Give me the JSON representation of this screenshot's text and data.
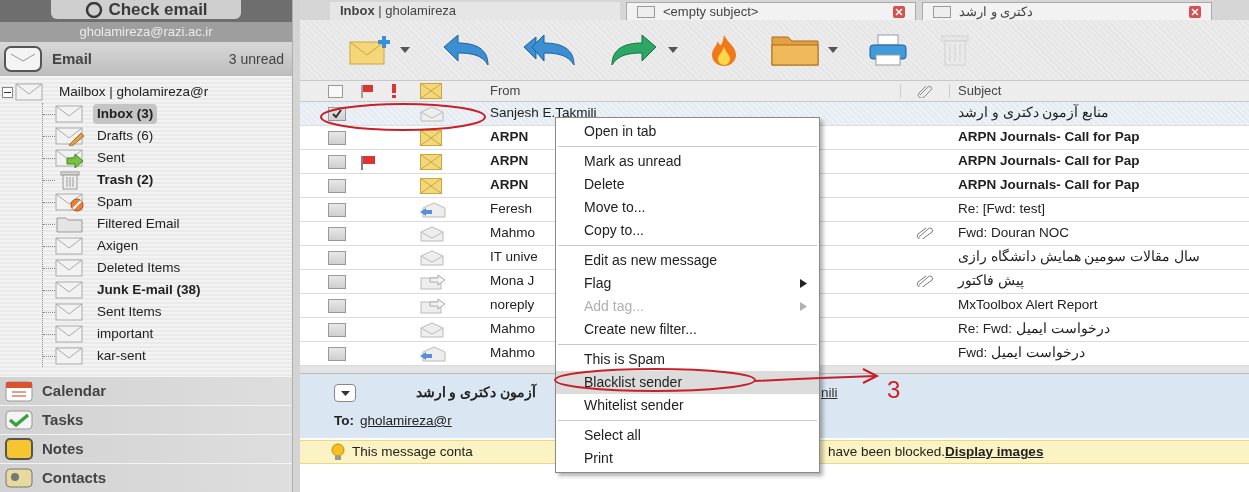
{
  "sidebar": {
    "check_email_button": "Check email",
    "account": "gholamireza@razi.ac.ir",
    "section": {
      "label": "Email",
      "unread": "3 unread"
    },
    "tree": {
      "label": "Mailbox | gholamireza@r",
      "expanded": true,
      "children": [
        {
          "label": "Inbox (3)",
          "kind": "inbox",
          "bold": true,
          "selected": true
        },
        {
          "label": "Drafts (6)",
          "kind": "drafts",
          "bold": false,
          "selected": false
        },
        {
          "label": "Sent",
          "kind": "sent",
          "bold": false,
          "selected": false
        },
        {
          "label": "Trash (2)",
          "kind": "trash",
          "bold": true,
          "selected": false
        },
        {
          "label": "Spam",
          "kind": "spam",
          "bold": false,
          "selected": false
        },
        {
          "label": "Filtered Email",
          "kind": "folder",
          "bold": false,
          "selected": false
        },
        {
          "label": "Axigen",
          "kind": "mail",
          "bold": false,
          "selected": false
        },
        {
          "label": "Deleted Items",
          "kind": "mail",
          "bold": false,
          "selected": false
        },
        {
          "label": "Junk E-mail (38)",
          "kind": "mail",
          "bold": true,
          "selected": false
        },
        {
          "label": "Sent Items",
          "kind": "mail",
          "bold": false,
          "selected": false
        },
        {
          "label": "important",
          "kind": "mail",
          "bold": false,
          "selected": false
        },
        {
          "label": "kar-sent",
          "kind": "mail",
          "bold": false,
          "selected": false
        }
      ]
    },
    "modules": [
      {
        "label": "Calendar",
        "kind": "calendar"
      },
      {
        "label": "Tasks",
        "kind": "tasks"
      },
      {
        "label": "Notes",
        "kind": "notes"
      },
      {
        "label": "Contacts",
        "kind": "contacts"
      }
    ]
  },
  "tabs": [
    {
      "label": "**Inbox** | gholamireza",
      "selected": true,
      "closable": false
    },
    {
      "label": "<empty subject>",
      "selected": false,
      "closable": true
    },
    {
      "label": "دکتری و ارشد",
      "selected": false,
      "closable": true
    }
  ],
  "toolbar": [
    {
      "kind": "new",
      "dropdown": true,
      "disabled": false
    },
    {
      "kind": "reply",
      "dropdown": false,
      "disabled": false
    },
    {
      "kind": "reply_all",
      "dropdown": false,
      "disabled": false
    },
    {
      "kind": "forward",
      "dropdown": true,
      "disabled": false
    },
    {
      "kind": "spam",
      "dropdown": false,
      "disabled": false
    },
    {
      "kind": "move",
      "dropdown": true,
      "disabled": false
    },
    {
      "kind": "print",
      "dropdown": false,
      "disabled": false
    },
    {
      "kind": "delete",
      "dropdown": false,
      "disabled": true
    }
  ],
  "message_list": {
    "select_all": {
      "checked": false
    },
    "columns": {
      "from": "From",
      "subject": "Subject"
    },
    "rows": [
      {
        "checked": true,
        "selected": true,
        "flagged": false,
        "kind": "read",
        "unread": false,
        "from": "Sanjesh E.Takmili",
        "attachment": false,
        "subject": "منابع آزمون دکتری و ارشد"
      },
      {
        "checked": false,
        "selected": false,
        "flagged": false,
        "kind": "unread",
        "unread": true,
        "from": "ARPN",
        "attachment": false,
        "subject": "ARPN Journals- Call for Pap"
      },
      {
        "checked": false,
        "selected": false,
        "flagged": true,
        "kind": "unread",
        "unread": true,
        "from": "ARPN",
        "attachment": false,
        "subject": "ARPN Journals- Call for Pap"
      },
      {
        "checked": false,
        "selected": false,
        "flagged": false,
        "kind": "unread",
        "unread": true,
        "from": "ARPN",
        "attachment": false,
        "subject": "ARPN Journals- Call for Pap"
      },
      {
        "checked": false,
        "selected": false,
        "flagged": false,
        "kind": "replied",
        "unread": false,
        "from": "Feresh",
        "attachment": false,
        "subject": "Re: [Fwd: test]"
      },
      {
        "checked": false,
        "selected": false,
        "flagged": false,
        "kind": "read",
        "unread": false,
        "from": "Mahmo",
        "attachment": true,
        "subject": "Fwd: Douran NOC"
      },
      {
        "checked": false,
        "selected": false,
        "flagged": false,
        "kind": "read",
        "unread": false,
        "from": "IT unive",
        "attachment": false,
        "subject": "سال مقالات سومین همایش دانشگاه رازی"
      },
      {
        "checked": false,
        "selected": false,
        "flagged": false,
        "kind": "forwarded",
        "unread": false,
        "from": "Mona J",
        "attachment": true,
        "subject": "پیش فاکتور"
      },
      {
        "checked": false,
        "selected": false,
        "flagged": false,
        "kind": "forwarded",
        "unread": false,
        "from": "noreply",
        "attachment": false,
        "subject": "MxToolbox Alert Report"
      },
      {
        "checked": false,
        "selected": false,
        "flagged": false,
        "kind": "read",
        "unread": false,
        "from": "Mahmo",
        "attachment": false,
        "subject": "Re: Fwd: درخواست ایمیل"
      },
      {
        "checked": false,
        "selected": false,
        "flagged": false,
        "kind": "replied",
        "unread": false,
        "from": "Mahmo",
        "attachment": false,
        "subject": "Fwd: درخواست ایمیل"
      }
    ]
  },
  "context_menu": {
    "groups": [
      [
        {
          "label": "Open in tab",
          "disabled": false,
          "submenu": false,
          "selected": false
        }
      ],
      [
        {
          "label": "Mark as unread",
          "disabled": false,
          "submenu": false,
          "selected": false
        },
        {
          "label": "Delete",
          "disabled": false,
          "submenu": false,
          "selected": false
        },
        {
          "label": "Move to...",
          "disabled": false,
          "submenu": false,
          "selected": false
        },
        {
          "label": "Copy to...",
          "disabled": false,
          "submenu": false,
          "selected": false
        }
      ],
      [
        {
          "label": "Edit as new message",
          "disabled": false,
          "submenu": false,
          "selected": false
        },
        {
          "label": "Flag",
          "disabled": false,
          "submenu": true,
          "selected": false
        },
        {
          "label": "Add tag...",
          "disabled": true,
          "submenu": true,
          "selected": false
        },
        {
          "label": "Create new filter...",
          "disabled": false,
          "submenu": false,
          "selected": false
        }
      ],
      [
        {
          "label": "This is Spam",
          "disabled": false,
          "submenu": false,
          "selected": false
        },
        {
          "label": "Blacklist sender",
          "disabled": false,
          "submenu": false,
          "selected": true
        },
        {
          "label": "Whitelist sender",
          "disabled": false,
          "submenu": false,
          "selected": false
        }
      ],
      [
        {
          "label": "Select all",
          "disabled": false,
          "submenu": false,
          "selected": false
        },
        {
          "label": "Print",
          "disabled": false,
          "submenu": false,
          "selected": false
        }
      ]
    ]
  },
  "preview": {
    "subject": "آزمون دکتری و ارشد",
    "from": "nili",
    "to_label": "To:",
    "to": "gholamireza@r",
    "notice": {
      "text_start": "This message conta",
      "text_end": "have been blocked.",
      "link": "Display images"
    }
  },
  "callout": {
    "label": "3"
  }
}
